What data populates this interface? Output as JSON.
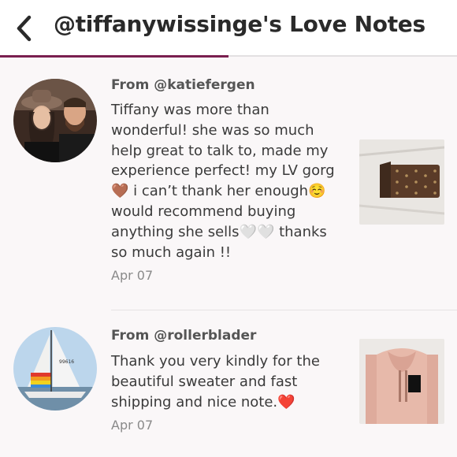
{
  "header": {
    "title": "@tiffanywissinge's Love Notes",
    "back_icon": "chevron-left-icon",
    "accent_color": "#7a1f4f"
  },
  "notes": [
    {
      "from": "From @katiefergen",
      "message_lines": [
        "Tiffany was more than",
        "wonderful! she was so much",
        "help great to talk to, made my",
        "experience perfect! my LV gorg",
        "🤎 i can’t thank her enough☺️",
        "would recommend buying",
        "anything she sells🤍🤍 thanks",
        "so much again !!"
      ],
      "date": "Apr 07",
      "avatar_desc": "couple-photo",
      "thumb_desc": "lv-pouch-photo"
    },
    {
      "from": "From @rollerblader",
      "message_lines": [
        "Thank you very kindly for the",
        "beautiful sweater and fast",
        "shipping and nice note.❤️"
      ],
      "date": "Apr 07",
      "avatar_desc": "sailboat-photo",
      "thumb_desc": "pink-sweater-photo"
    }
  ]
}
